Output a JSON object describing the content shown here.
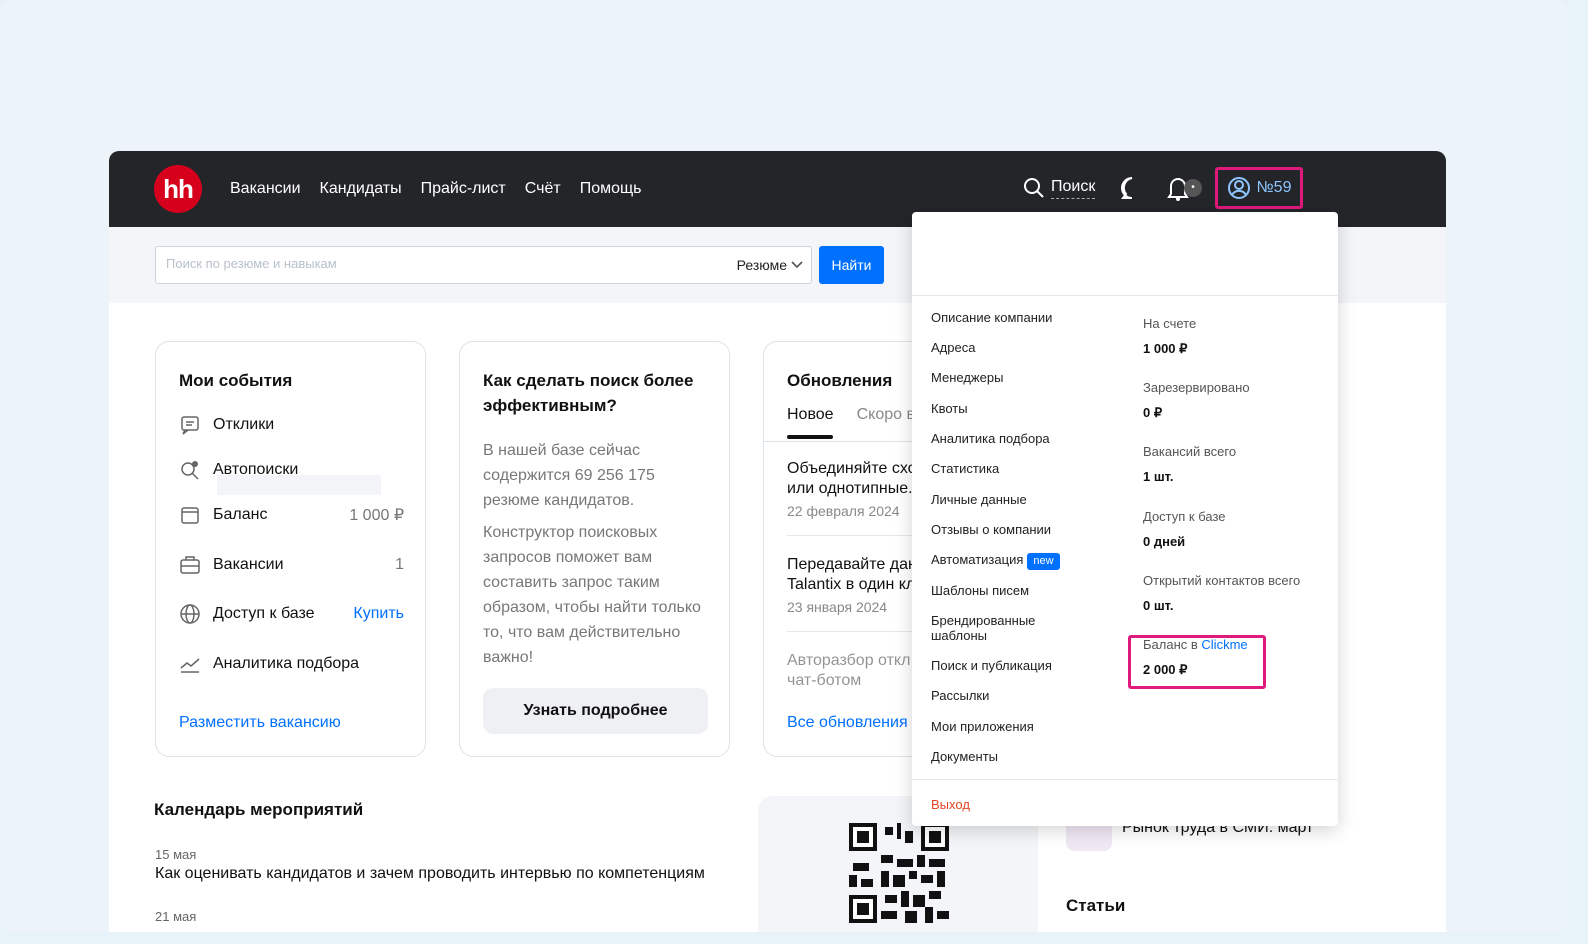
{
  "header": {
    "logo": "hh",
    "nav": [
      "Вакансии",
      "Кандидаты",
      "Прайс-лист",
      "Счёт",
      "Помощь"
    ],
    "search_label": "Поиск",
    "notif_count": "•",
    "account_label": "№59"
  },
  "search": {
    "placeholder": "Поиск по резюме и навыкам",
    "type_select": "Резюме",
    "button": "Найти"
  },
  "events": {
    "title": "Мои события",
    "items": [
      {
        "label": "Отклики",
        "icon": "chat-icon"
      },
      {
        "label": "Автопоиски",
        "icon": "autosearch-icon"
      },
      {
        "label": "Баланс",
        "value": "1 000 ₽",
        "icon": "wallet-icon"
      },
      {
        "label": "Вакансии",
        "value": "1",
        "icon": "briefcase-icon"
      },
      {
        "label": "Доступ к базе",
        "action": "Купить",
        "icon": "globe-icon"
      },
      {
        "label": "Аналитика подбора",
        "icon": "chart-icon"
      }
    ],
    "post_link": "Разместить вакансию"
  },
  "tips": {
    "title": "Как сделать поиск более эффективным?",
    "p1": "В нашей базе сейчас содержится 69 256 175 резюме кандидатов.",
    "p2": "Конструктор поисковых запросов поможет вам составить запрос таким образом, чтобы найти только то, что вам действительно важно!",
    "button": "Узнать подробнее"
  },
  "updates": {
    "title": "Обновления",
    "tab_new": "Новое",
    "tab_soon": "Скоро в",
    "items": [
      {
        "line1": "Объединяйте схо",
        "line2": "или однотипные.",
        "date": "22 февраля 2024"
      },
      {
        "line1": "Передавайте дан",
        "line2": "Talantix в один кл",
        "date": "23 января 2024"
      },
      {
        "line1": "Авторазбор откл",
        "line2": "чат-ботом",
        "date": ""
      }
    ],
    "all_link": "Все обновления"
  },
  "calendar": {
    "title": "Календарь мероприятий",
    "date1": "15 мая",
    "event1": "Как оценивать кандидатов и зачем проводить интервью по компетенциям",
    "date2": "21 мая"
  },
  "side": {
    "market": "Рынок труда в СМИ: март",
    "articles": "Статьи"
  },
  "menu": {
    "links": [
      "Описание компании",
      "Адреса",
      "Менеджеры",
      "Квоты",
      "Аналитика подбора",
      "Статистика",
      "Личные данные",
      "Отзывы о компании",
      "Автоматизация",
      "Шаблоны писем",
      "Брендированные",
      "шаблоны",
      "Поиск и публикация",
      "Рассылки",
      "Мои приложения",
      "Документы"
    ],
    "new_badge": "new",
    "stats": [
      {
        "label": "На счете",
        "value": "1 000 ₽"
      },
      {
        "label": "Зарезервировано",
        "value": "0 ₽"
      },
      {
        "label": "Вакансий всего",
        "value": "1 шт."
      },
      {
        "label": "Доступ к базе",
        "value": "0 дней"
      },
      {
        "label": "Открытий контактов всего",
        "value": "0 шт."
      }
    ],
    "clickme_prefix": "Баланс в",
    "clickme_name": "Clickme",
    "clickme_value": "2 000 ₽",
    "logout": "Выход"
  },
  "colors": {
    "accent": "#0070ff",
    "brand": "#d6001c",
    "highlight": "#e0197d",
    "topbar": "#232529"
  }
}
